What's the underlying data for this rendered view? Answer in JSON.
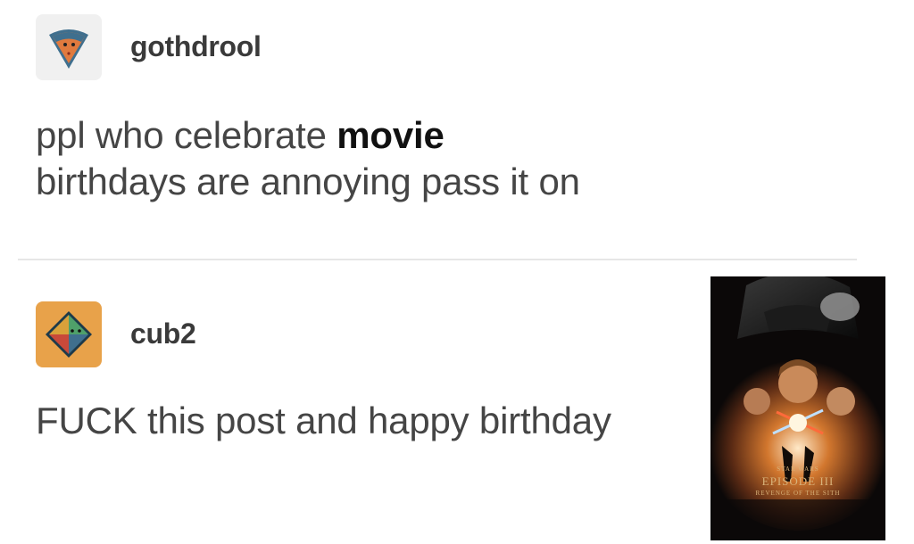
{
  "post1": {
    "username": "gothdrool",
    "text_line1_plain": "ppl who celebrate ",
    "text_line1_bold": "movie",
    "text_line2": "birthdays are annoying pass it on",
    "avatar_icon": "pizza-slice-icon",
    "avatar_bg": "#f0f0f0"
  },
  "post2": {
    "username": "cub2",
    "text": "FUCK this post and happy birthday",
    "avatar_icon": "diamond-gem-icon",
    "avatar_bg": "#e8a24a",
    "poster": {
      "brand": "STAR WARS",
      "title": "EPISODE III",
      "subtitle": "REVENGE OF THE SITH"
    }
  }
}
